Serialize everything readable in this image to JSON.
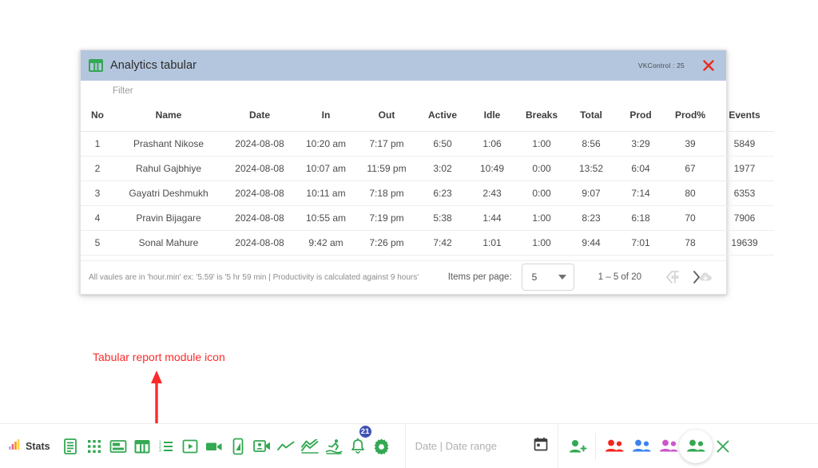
{
  "dialog": {
    "title": "Analytics tabular",
    "title_icon": "table-chart-icon",
    "account_label": "VKControl :  25",
    "close_icon": "close-icon",
    "filter_placeholder": "Filter",
    "table": {
      "headers": [
        "No",
        "Name",
        "Date",
        "In",
        "Out",
        "Active",
        "Idle",
        "Breaks",
        "Total",
        "Prod",
        "Prod%",
        "Events"
      ],
      "rows": [
        [
          "1",
          "Prashant Nikose",
          "2024-08-08",
          "10:20 am",
          "7:17 pm",
          "6:50",
          "1:06",
          "1:00",
          "8:56",
          "3:29",
          "39",
          "5849"
        ],
        [
          "2",
          "Rahul Gajbhiye",
          "2024-08-08",
          "10:07 am",
          "11:59 pm",
          "3:02",
          "10:49",
          "0:00",
          "13:52",
          "6:04",
          "67",
          "1977"
        ],
        [
          "3",
          "Gayatri Deshmukh",
          "2024-08-08",
          "10:11 am",
          "7:18 pm",
          "6:23",
          "2:43",
          "0:00",
          "9:07",
          "7:14",
          "80",
          "6353"
        ],
        [
          "4",
          "Pravin Bijagare",
          "2024-08-08",
          "10:55 am",
          "7:19 pm",
          "5:38",
          "1:44",
          "1:00",
          "8:23",
          "6:18",
          "70",
          "7906"
        ],
        [
          "5",
          "Sonal Mahure",
          "2024-08-08",
          "9:42 am",
          "7:26 pm",
          "7:42",
          "1:01",
          "1:00",
          "9:44",
          "7:01",
          "78",
          "19639"
        ]
      ]
    },
    "paginator": {
      "items_per_page_label": "Items per page:",
      "items_per_page_value": "5",
      "range_label": "1 – 5 of 20",
      "prev_icon": "chevron-left-icon",
      "next_icon": "chevron-right-icon"
    },
    "footer": {
      "note": "All vaules are in 'hour.min' ex: '5.59' is '5 hr 59 min | Productivity is calculated against 9 hours'",
      "pin_icon": "pin-icon",
      "download_icon": "cloud-download-icon"
    }
  },
  "annotation": {
    "text": "Tabular report module icon",
    "color": "#fd2a2a"
  },
  "toolbar": {
    "stats_label": "Stats",
    "stats_icon": "bar-chart-icon",
    "modules": [
      {
        "name": "notes-icon"
      },
      {
        "name": "apps-grid-icon"
      },
      {
        "name": "dashboard-layout-icon"
      },
      {
        "name": "table-chart-icon"
      },
      {
        "name": "ordered-list-icon"
      },
      {
        "name": "slideshow-icon"
      },
      {
        "name": "video-camera-icon"
      },
      {
        "name": "mobile-device-icon"
      },
      {
        "name": "video-contact-icon"
      },
      {
        "name": "line-chart-icon"
      },
      {
        "name": "trending-chart-icon"
      },
      {
        "name": "surfer-activity-icon"
      }
    ],
    "notifications": {
      "icon": "bell-icon",
      "badge_count": "21",
      "badge_color": "#3f51b5"
    },
    "settings_icon": "gear-icon",
    "date_field": {
      "placeholder": "Date | Date range",
      "calendar_icon": "calendar-icon"
    },
    "add_person_icon": "person-add-icon",
    "groups": [
      {
        "name": "group-red",
        "color": "#f4251c"
      },
      {
        "name": "group-blue",
        "color": "#3b84f0"
      },
      {
        "name": "group-purple",
        "color": "#cc55cc"
      },
      {
        "name": "group-green",
        "color": "#34a853",
        "active": true
      }
    ],
    "close_icon": "close-icon"
  },
  "colors": {
    "titlebar": "#b4c6de",
    "green": "#34a853",
    "red": "#ea4335"
  }
}
